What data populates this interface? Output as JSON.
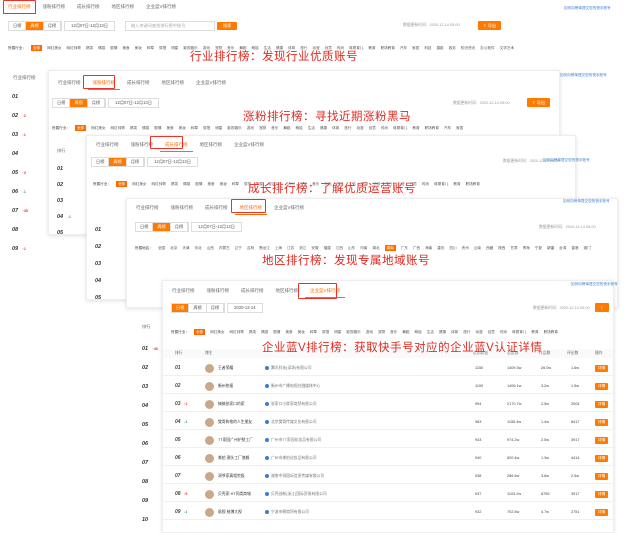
{
  "tabs": {
    "industry": "行业排行榜",
    "rising": "涨粉排行榜",
    "growth": "成长排行榜",
    "region": "地区排行榜",
    "enterprise": "企业蓝V排行榜"
  },
  "controls": {
    "daily": "日榜",
    "weekly": "周榜",
    "monthly": "月榜",
    "date_range": "12月07日-12月13日",
    "date_single": "2020-12-14",
    "search_placeholder": "输入关键词查找排行榜中账号",
    "search_button": "搜索",
    "updated": "数据更新时间：2020-12-14 05:00",
    "export": "导出",
    "hint": "如何向榜单提交您的快手账号"
  },
  "categories": {
    "label": "所属行业：",
    "items": [
      "全部",
      "网红美女",
      "网红帅哥",
      "搞笑",
      "情感",
      "剧情",
      "美食",
      "美妆",
      "种草",
      "穿搭",
      "明星",
      "影视娱乐",
      "游戏",
      "宠物",
      "音乐",
      "舞蹈",
      "萌娃",
      "生活",
      "健康",
      "体育",
      "旅行",
      "动漫",
      "创意",
      "时尚",
      "母婴育儿",
      "教育",
      "职场教育",
      "汽车",
      "家居",
      "科技",
      "摄影",
      "政务",
      "知识资讯",
      "办公软件",
      "文学艺术"
    ]
  },
  "regions": {
    "label": "所属地区：",
    "items": [
      "全国",
      "北京",
      "天津",
      "河北",
      "山西",
      "内蒙古",
      "辽宁",
      "吉林",
      "黑龙江",
      "上海",
      "江苏",
      "浙江",
      "安徽",
      "福建",
      "江西",
      "山东",
      "河南",
      "湖北",
      "湖南",
      "广东",
      "广西",
      "海南",
      "重庆",
      "四川",
      "贵州",
      "云南",
      "西藏",
      "陕西",
      "甘肃",
      "青海",
      "宁夏",
      "新疆",
      "台湾",
      "香港",
      "澳门"
    ]
  },
  "captions": {
    "industry": "行业排行榜：发现行业优质账号",
    "rising": "涨粉排行榜：寻找近期涨粉黑马",
    "growth": "成长排行榜：了解优质运营账号",
    "region": "地区排行榜：发现专属地域账号",
    "enterprise": "企业蓝V排行榜：获取快手号对应的企业蓝V认证详情"
  },
  "rank_header": "排行",
  "ranks_a": [
    {
      "n": "01",
      "c": ""
    },
    {
      "n": "02",
      "c": "↑2"
    },
    {
      "n": "03",
      "c": "↑1"
    },
    {
      "n": "04",
      "c": ""
    },
    {
      "n": "05",
      "c": "↑3"
    },
    {
      "n": "06",
      "c": "↓1"
    },
    {
      "n": "07",
      "c": "↑35"
    },
    {
      "n": "08",
      "c": ""
    },
    {
      "n": "09",
      "c": "↑1"
    }
  ],
  "ranks_b": [
    {
      "n": "01",
      "c": ""
    },
    {
      "n": "02",
      "c": ""
    },
    {
      "n": "03",
      "c": ""
    },
    {
      "n": "04",
      "c": "↓1"
    },
    {
      "n": "05",
      "c": ""
    },
    {
      "n": "06",
      "c": ""
    },
    {
      "n": "07",
      "c": ""
    },
    {
      "n": "08",
      "c": ""
    },
    {
      "n": "09",
      "c": ""
    }
  ],
  "ranks_c": [
    {
      "n": "01",
      "c": ""
    },
    {
      "n": "02",
      "c": ""
    },
    {
      "n": "03",
      "c": ""
    },
    {
      "n": "04",
      "c": ""
    },
    {
      "n": "05",
      "c": ""
    },
    {
      "n": "06",
      "c": ""
    },
    {
      "n": "07",
      "c": ""
    },
    {
      "n": "08",
      "c": ""
    },
    {
      "n": "09",
      "c": ""
    }
  ],
  "ranks_d": [
    {
      "n": "01",
      "c": "↑40"
    },
    {
      "n": "02",
      "c": ""
    },
    {
      "n": "03",
      "c": ""
    },
    {
      "n": "04",
      "c": ""
    },
    {
      "n": "05",
      "c": ""
    },
    {
      "n": "06",
      "c": ""
    },
    {
      "n": "07",
      "c": ""
    },
    {
      "n": "08",
      "c": ""
    },
    {
      "n": "09",
      "c": ""
    },
    {
      "n": "10",
      "c": ""
    }
  ],
  "table": {
    "headers": [
      "排行",
      "博主",
      "",
      "近期粉丝",
      "总赞数",
      "作品数",
      "评论数",
      "操作"
    ],
    "detail": "详情",
    "rows": [
      {
        "rank": "01",
        "chg": "",
        "name": "王者荣耀",
        "company": "腾讯科技(深圳)有限公司",
        "a": "1150",
        "b": "1409.3w",
        "c": "26.0w",
        "d": "1.6w"
      },
      {
        "rank": "02",
        "chg": "",
        "name": "衡州热报",
        "company": "衡州市广播电视台融媒体中心",
        "a": "1100",
        "b": "1406.1w",
        "c": "3.2w",
        "d": "1.5w"
      },
      {
        "rank": "03",
        "chg": "↑1",
        "name": "搞搞张家口的家",
        "company": "张家口小胖家商贸有限公司",
        "a": "994",
        "b": "2170.7w",
        "c": "2.5w",
        "d": "2004"
      },
      {
        "rank": "04",
        "chg": "↓1",
        "name": "樊哥和他的人生朋友",
        "company": "北京樊哥传媒文化有限公司",
        "a": "983",
        "b": "1155.4w",
        "c": "1.4w",
        "d": "8417"
      },
      {
        "rank": "05",
        "chg": "",
        "name": "TT家园广州护肤工厂",
        "company": "广州市TT家园化妆品有限公司",
        "a": "943",
        "b": "974.2w",
        "c": "2.5w",
        "d": "3917"
      },
      {
        "rank": "06",
        "chg": "",
        "name": "美拍 潮头工厂旗舰",
        "company": "广州市美拍化妆品有限公司",
        "a": "940",
        "b": "820.4w",
        "c": "1.3w",
        "d": "4414"
      },
      {
        "rank": "07",
        "chg": "",
        "name": "洞爷家真相究极",
        "company": "湖南中洞国际信息传媒有限公司",
        "a": "938",
        "b": "286.5w",
        "c": "3.6w",
        "d": "2.5w"
      },
      {
        "rank": "08",
        "chg": "↑5",
        "name": "贝壳家·HT同类商城",
        "company": "贝壳创新(浙江)国际贸易有限公司",
        "a": "937",
        "b": "1103.2w",
        "c": "8755",
        "d": "3917"
      },
      {
        "rank": "09",
        "chg": "↓1",
        "name": "晗视 柚博大视",
        "company": "宁波市朝商贸有限公司",
        "a": "932",
        "b": "702.5w",
        "c": "4.7w",
        "d": "2751"
      }
    ]
  }
}
